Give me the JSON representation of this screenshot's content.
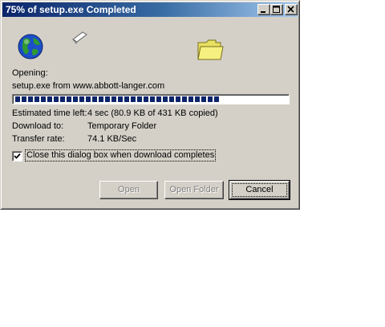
{
  "window": {
    "title": "75% of setup.exe Completed"
  },
  "status": {
    "opening_label": "Opening:",
    "source_text": "setup.exe from www.abbott-langer.com",
    "progress_percent": 75
  },
  "details": {
    "time_left_label": "Estimated time left:",
    "time_left_value": "4 sec (80.9 KB of 431 KB copied)",
    "download_to_label": "Download to:",
    "download_to_value": "Temporary Folder",
    "transfer_rate_label": "Transfer rate:",
    "transfer_rate_value": "74.1 KB/Sec"
  },
  "options": {
    "close_on_complete_label": "Close this dialog box when download completes",
    "close_on_complete_checked": true
  },
  "buttons": {
    "open_label": "Open",
    "open_folder_label": "Open Folder",
    "cancel_label": "Cancel"
  },
  "icons": {
    "globe": "globe-icon",
    "paper": "flying-document-icon",
    "folder": "folder-icon"
  },
  "colors": {
    "titlebar_start": "#0a246a",
    "titlebar_end": "#a6caf0",
    "progress_block": "#0a246a",
    "dialog_face": "#d4d0c8"
  }
}
